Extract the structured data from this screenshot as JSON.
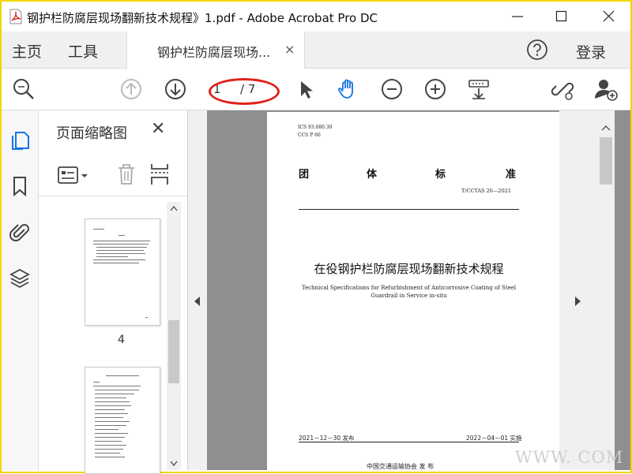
{
  "window": {
    "title": "钢护栏防腐层现场翻新技术规程》1.pdf - Adobe Acrobat Pro DC"
  },
  "menu": {
    "home": "主页",
    "tools": "工具",
    "doc_tab": "钢护栏防腐层现场...",
    "doc_tab_close": "×",
    "login": "登录"
  },
  "toolbar": {
    "current_page": "1",
    "total_pages": "/ 7"
  },
  "thumbnails": {
    "title": "页面缩略图",
    "close": "✕",
    "page_label": "4"
  },
  "document": {
    "ics": "ICS  93.080.30",
    "ccs": "CCS  P  66",
    "std_chars": [
      "团",
      "体",
      "标",
      "准"
    ],
    "std_number": "T/CCTAS 26—2021",
    "title_cn": "在役钢护栏防腐层现场翻新技术规程",
    "title_en_1": "Technical Specifications for Refurbishment of Anticorrosive Coating of Steel",
    "title_en_2": "Guardrail in Service in-situ",
    "issue_date": "2021－12－30 发布",
    "impl_date": "2022－04－01 实施",
    "publisher": "中国交通运输协会      发 布"
  },
  "watermark": "WWW.       COM",
  "colors": {
    "frame": "#f2d500",
    "annotation": "#e0231c",
    "hand_tool": "#1473e6"
  }
}
